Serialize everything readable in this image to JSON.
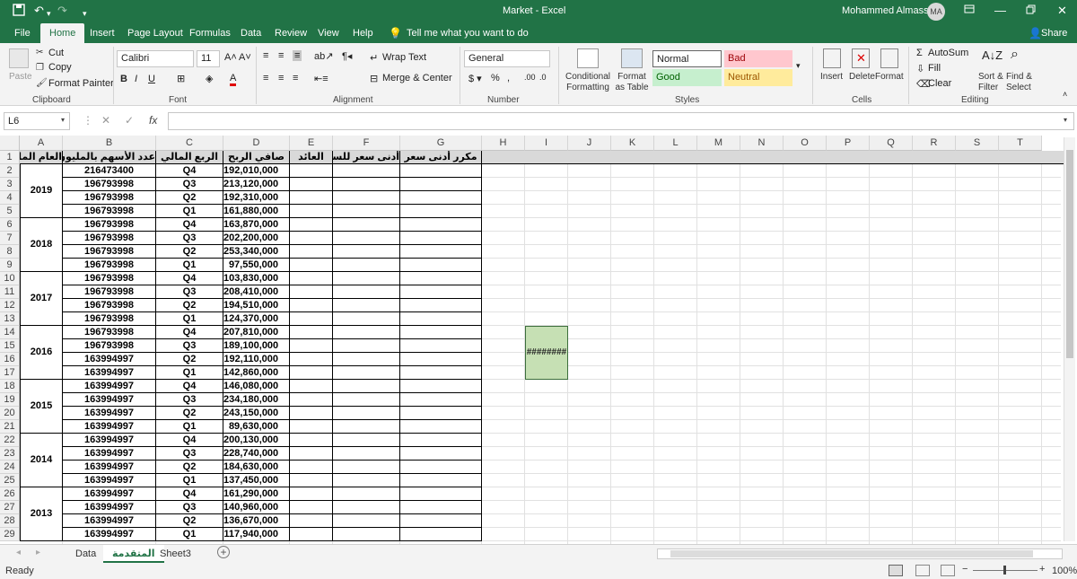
{
  "window": {
    "title": "Market  -  Excel",
    "user": "Mohammed Almasseri",
    "user_initials": "MA"
  },
  "ribbon_tabs": [
    "File",
    "Home",
    "Insert",
    "Page Layout",
    "Formulas",
    "Data",
    "Review",
    "View",
    "Help"
  ],
  "tell_me": "Tell me what you want to do",
  "share": "Share",
  "clipboard": {
    "paste": "Paste",
    "cut": "Cut",
    "copy": "Copy",
    "format_painter": "Format Painter",
    "label": "Clipboard"
  },
  "font": {
    "name": "Calibri",
    "size": "11",
    "label": "Font"
  },
  "alignment": {
    "wrap": "Wrap Text",
    "merge": "Merge & Center",
    "label": "Alignment"
  },
  "number": {
    "format": "General",
    "label": "Number"
  },
  "styles": {
    "conditional": "Conditional Formatting",
    "format_table": "Format as Table",
    "normal": "Normal",
    "bad": "Bad",
    "good": "Good",
    "neutral": "Neutral",
    "label": "Styles"
  },
  "cells_group": {
    "insert": "Insert",
    "delete": "Delete",
    "format": "Format",
    "label": "Cells"
  },
  "editing": {
    "autosum": "AutoSum",
    "fill": "Fill",
    "clear": "Clear",
    "sort": "Sort & Filter",
    "find": "Find & Select",
    "label": "Editing"
  },
  "name_box": "L6",
  "formula": "",
  "columns": [
    "A",
    "B",
    "C",
    "D",
    "E",
    "F",
    "G",
    "H",
    "I",
    "J",
    "K",
    "L",
    "M",
    "N",
    "O",
    "P",
    "Q",
    "R",
    "S",
    "T"
  ],
  "headers": {
    "A": "العام المالي",
    "B": "عدد الأسهم بالمليون",
    "C": "الربع المالي",
    "D": "صافي الربح",
    "E": "العائد",
    "F": "أدنى سعر للسهم",
    "G": "مكرر أدنى سعر"
  },
  "years": [
    "2019",
    "2018",
    "2017",
    "2016",
    "2015",
    "2014",
    "2013"
  ],
  "rows": [
    {
      "n": "2",
      "shares": "216473400",
      "q": "Q4",
      "profit": "192,010,000"
    },
    {
      "n": "3",
      "shares": "196793998",
      "q": "Q3",
      "profit": "213,120,000"
    },
    {
      "n": "4",
      "shares": "196793998",
      "q": "Q2",
      "profit": "192,310,000"
    },
    {
      "n": "5",
      "shares": "196793998",
      "q": "Q1",
      "profit": "161,880,000"
    },
    {
      "n": "6",
      "shares": "196793998",
      "q": "Q4",
      "profit": "163,870,000"
    },
    {
      "n": "7",
      "shares": "196793998",
      "q": "Q3",
      "profit": "202,200,000"
    },
    {
      "n": "8",
      "shares": "196793998",
      "q": "Q2",
      "profit": "253,340,000"
    },
    {
      "n": "9",
      "shares": "196793998",
      "q": "Q1",
      "profit": "97,550,000"
    },
    {
      "n": "10",
      "shares": "196793998",
      "q": "Q4",
      "profit": "103,830,000"
    },
    {
      "n": "11",
      "shares": "196793998",
      "q": "Q3",
      "profit": "208,410,000"
    },
    {
      "n": "12",
      "shares": "196793998",
      "q": "Q2",
      "profit": "194,510,000"
    },
    {
      "n": "13",
      "shares": "196793998",
      "q": "Q1",
      "profit": "124,370,000"
    },
    {
      "n": "14",
      "shares": "196793998",
      "q": "Q4",
      "profit": "207,810,000"
    },
    {
      "n": "15",
      "shares": "196793998",
      "q": "Q3",
      "profit": "189,100,000"
    },
    {
      "n": "16",
      "shares": "163994997",
      "q": "Q2",
      "profit": "192,110,000"
    },
    {
      "n": "17",
      "shares": "163994997",
      "q": "Q1",
      "profit": "142,860,000"
    },
    {
      "n": "18",
      "shares": "163994997",
      "q": "Q4",
      "profit": "146,080,000"
    },
    {
      "n": "19",
      "shares": "163994997",
      "q": "Q3",
      "profit": "234,180,000"
    },
    {
      "n": "20",
      "shares": "163994997",
      "q": "Q2",
      "profit": "243,150,000"
    },
    {
      "n": "21",
      "shares": "163994997",
      "q": "Q1",
      "profit": "89,630,000"
    },
    {
      "n": "22",
      "shares": "163994997",
      "q": "Q4",
      "profit": "200,130,000"
    },
    {
      "n": "23",
      "shares": "163994997",
      "q": "Q3",
      "profit": "228,740,000"
    },
    {
      "n": "24",
      "shares": "163994997",
      "q": "Q2",
      "profit": "184,630,000"
    },
    {
      "n": "25",
      "shares": "163994997",
      "q": "Q1",
      "profit": "137,450,000"
    },
    {
      "n": "26",
      "shares": "163994997",
      "q": "Q4",
      "profit": "161,290,000"
    },
    {
      "n": "27",
      "shares": "163994997",
      "q": "Q3",
      "profit": "140,960,000"
    },
    {
      "n": "28",
      "shares": "163994997",
      "q": "Q2",
      "profit": "136,670,000"
    },
    {
      "n": "29",
      "shares": "163994997",
      "q": "Q1",
      "profit": "117,940,000"
    }
  ],
  "selected_cell_value": "########",
  "sheet_tabs": [
    "Data",
    "المتقدمة",
    "Sheet3"
  ],
  "active_sheet": "المتقدمة",
  "status": {
    "ready": "Ready",
    "zoom": "100%"
  }
}
